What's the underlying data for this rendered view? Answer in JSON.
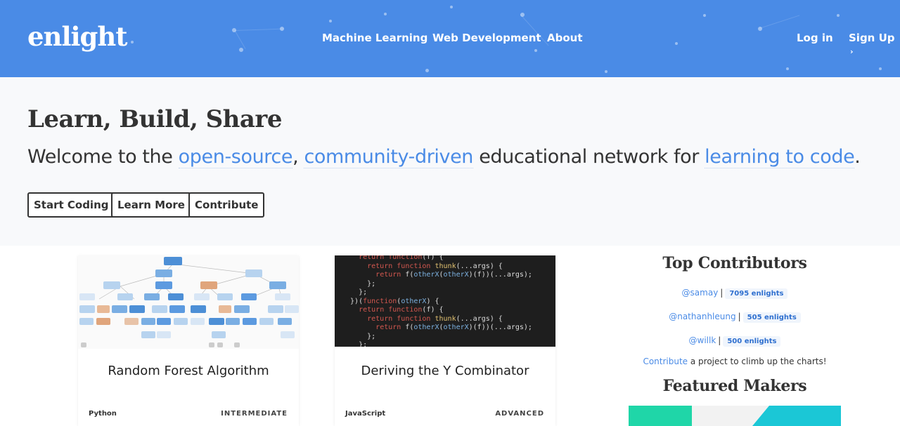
{
  "header": {
    "logo": "enlight",
    "nav": [
      "Machine Learning",
      "Web Development",
      "About"
    ],
    "login": "Log in",
    "signup": "Sign Up",
    "signup_icon": "chevron-right-icon",
    "background_color": "#4a8be6"
  },
  "hero": {
    "title": "Learn, Build, Share",
    "subtitle": {
      "part1": "Welcome to the ",
      "link1": "open-source",
      "part2": ", ",
      "link2": "community-driven",
      "part3": " educational network for ",
      "link3": "learning to code",
      "part4": "."
    },
    "buttons": [
      "Start Coding",
      "Learn More",
      "Contribute"
    ],
    "accent_color": "#4a8be6"
  },
  "cards": [
    {
      "title": "Random Forest Algorithm",
      "language": "Python",
      "level": "INTERMEDIATE"
    },
    {
      "title": "Deriving the Y Combinator",
      "language": "JavaScript",
      "level": "ADVANCED"
    }
  ],
  "code_snippet": [
    "    return function(f) {",
    "      return function thunk(...args) {",
    "        return f(otherX(otherX)(f))(...args);",
    "      };",
    "    };",
    "  })(function(otherX) {",
    "    return function(f) {",
    "      return function thunk(...args) {",
    "        return f(otherX(otherX)(f))(...args);",
    "      };",
    "    };"
  ],
  "sidebar": {
    "top_title": "Top Contributors",
    "contributors": [
      {
        "user": "@samay",
        "count": "7095 enlights"
      },
      {
        "user": "@nathanhleung",
        "count": "505 enlights"
      },
      {
        "user": "@willk",
        "count": "500 enlights"
      }
    ],
    "note_link": "Contribute",
    "note_text": " a project to climb up the charts!",
    "makers_title": "Featured Makers"
  }
}
